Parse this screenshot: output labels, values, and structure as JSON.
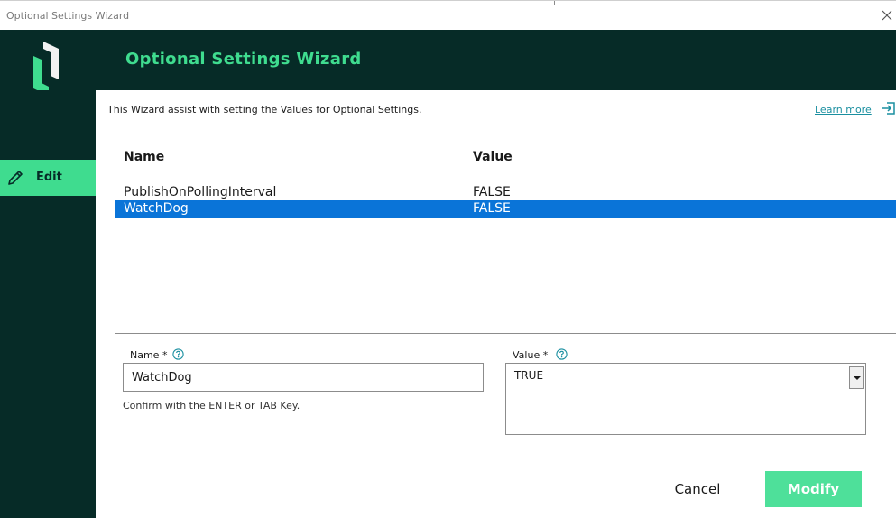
{
  "window": {
    "title": "Optional Settings Wizard",
    "close_icon": "close-icon"
  },
  "header": {
    "title": "Optional Settings Wizard",
    "logo": "brand-logo-icon"
  },
  "sidebar": {
    "items": [
      {
        "label": "Edit",
        "icon": "pencil-icon",
        "active": true
      }
    ]
  },
  "content": {
    "intro": "This Wizard assist with setting the Values for Optional Settings.",
    "learn_more": "Learn more",
    "learn_more_icon": "open-external-icon"
  },
  "table": {
    "columns": [
      "Name",
      "Value"
    ],
    "rows": [
      {
        "name": "PublishOnPollingInterval",
        "value": "FALSE",
        "selected": false
      },
      {
        "name": "WatchDog",
        "value": "FALSE",
        "selected": true
      }
    ]
  },
  "form": {
    "name_label": "Name *",
    "name_value": "WatchDog",
    "hint": "Confirm with the ENTER or TAB Key.",
    "value_label": "Value *",
    "value_selected": "TRUE",
    "help_icon": "help-circle-icon"
  },
  "buttons": {
    "cancel": "Cancel",
    "modify": "Modify"
  },
  "colors": {
    "brand_dark": "#062b27",
    "brand_green": "#3fdc8f",
    "selection_blue": "#0a74d8",
    "link_teal": "#1a8fa0"
  }
}
